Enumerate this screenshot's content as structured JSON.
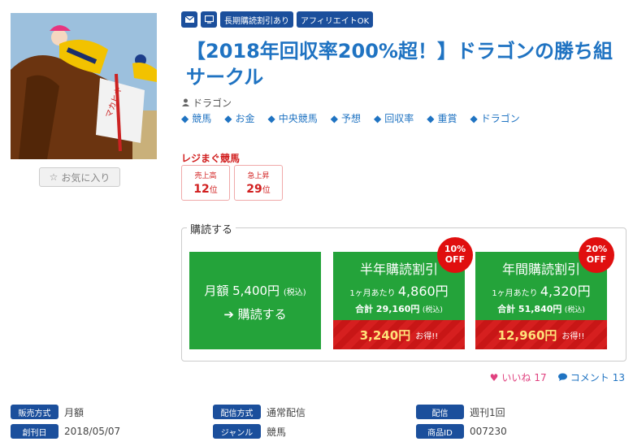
{
  "badges": [
    "長期購読割引あり",
    "アフィリエイトOK"
  ],
  "badge_icons": [
    "mail-icon",
    "monitor-icon"
  ],
  "favorite": {
    "label": "お気に入り"
  },
  "title": "【2018年回収率200%超！】ドラゴンの勝ち組サークル",
  "author": "ドラゴン",
  "tags": [
    "競馬",
    "お金",
    "中央競馬",
    "予想",
    "回収率",
    "重賞",
    "ドラゴン"
  ],
  "ranking": {
    "heading": "レジまぐ競馬",
    "items": [
      {
        "label": "売上高",
        "value": "12",
        "unit": "位"
      },
      {
        "label": "急上昇",
        "value": "29",
        "unit": "位"
      }
    ]
  },
  "subscribe": {
    "legend": "購読する",
    "monthly": {
      "price": "月額 5,400円",
      "tax": "(税込)",
      "buy": "購読する"
    },
    "half": {
      "title": "半年購読割引",
      "per_label": "1ヶ月あたり",
      "per_price": "4,860円",
      "total": "合計 29,160円",
      "tax": "(税込)",
      "saving": "3,240円",
      "otoku": "お得!!",
      "off_pct": "10%",
      "off": "OFF"
    },
    "year": {
      "title": "年間購読割引",
      "per_label": "1ヶ月あたり",
      "per_price": "4,320円",
      "total": "合計 51,840円",
      "tax": "(税込)",
      "saving": "12,960円",
      "otoku": "お得!!",
      "off_pct": "20%",
      "off": "OFF"
    }
  },
  "social": {
    "like_label": "いいね",
    "like_count": "17",
    "comment_label": "コメント",
    "comment_count": "13"
  },
  "meta": [
    {
      "label": "販売方式",
      "value": "月額"
    },
    {
      "label": "配信方式",
      "value": "通常配信"
    },
    {
      "label": "配信",
      "value": "週刊1回"
    },
    {
      "label": "創刊日",
      "value": "2018/05/07"
    },
    {
      "label": "ジャンル",
      "value": "競馬"
    },
    {
      "label": "商品ID",
      "value": "007230"
    }
  ],
  "thumbnail": {
    "saddle_text": "マカヒキ"
  },
  "colors": {
    "accent": "#1f73c2",
    "badge": "#1b4f9c",
    "green": "#24a33a",
    "red": "#d61f1f"
  }
}
